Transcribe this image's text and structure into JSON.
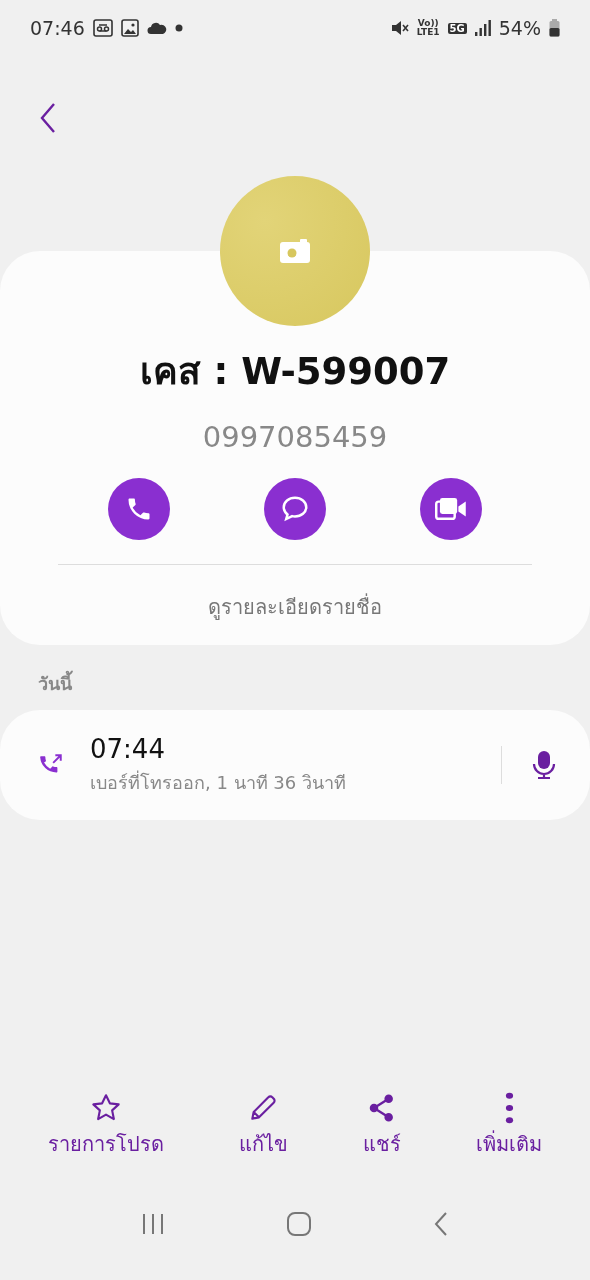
{
  "status_bar": {
    "time": "07:46",
    "volte": "Vo))",
    "lte": "LTE1",
    "network": "5G",
    "battery": "54%"
  },
  "contact": {
    "name": "เคส : W-599007",
    "phone": "0997085459",
    "details_link": "ดูรายละเอียดรายชื่อ"
  },
  "actions": [
    {
      "kind": "call"
    },
    {
      "kind": "message"
    },
    {
      "kind": "video"
    }
  ],
  "history": {
    "heading": "วันนี้",
    "calls": [
      {
        "kind": "outgoing",
        "time": "07:44",
        "description": "เบอร์ที่โทรออก, 1 นาที 36 วินาที",
        "recorded": true
      }
    ]
  },
  "bottom_bar": [
    {
      "kind": "favorite",
      "label": "รายการโปรด"
    },
    {
      "kind": "edit",
      "label": "แก้ไข"
    },
    {
      "kind": "share",
      "label": "แชร์"
    },
    {
      "kind": "more",
      "label": "เพิ่มเติม"
    }
  ]
}
